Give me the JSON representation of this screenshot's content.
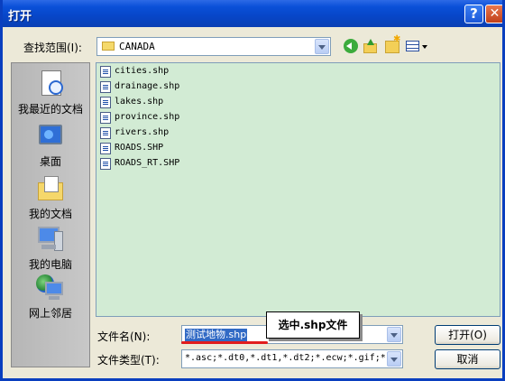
{
  "window": {
    "title": "打开",
    "help_symbol": "?",
    "close_symbol": "✕"
  },
  "lookin": {
    "label": "查找范围(I):",
    "value": "CANADA"
  },
  "toolbar": {
    "icons": [
      "back-icon",
      "up-folder-icon",
      "new-folder-icon",
      "view-menu-icon"
    ]
  },
  "places": [
    {
      "label": "我最近的文档",
      "icon": "recent-documents-icon"
    },
    {
      "label": "桌面",
      "icon": "desktop-icon"
    },
    {
      "label": "我的文档",
      "icon": "my-documents-icon"
    },
    {
      "label": "我的电脑",
      "icon": "my-computer-icon"
    },
    {
      "label": "网上邻居",
      "icon": "network-places-icon"
    }
  ],
  "files": [
    "cities.shp",
    "drainage.shp",
    "lakes.shp",
    "province.shp",
    "rivers.shp",
    "ROADS.SHP",
    "ROADS_RT.SHP"
  ],
  "filename": {
    "label": "文件名(N):",
    "value": "测试地物.shp"
  },
  "filetype": {
    "label": "文件类型(T):",
    "value": "*.asc;*.dt0,*.dt1,*.dt2;*.ecw;*.gif;*"
  },
  "buttons": {
    "open": "打开(O)",
    "cancel": "取消"
  },
  "annotation": {
    "text": "选中.shp文件",
    "underline_color": "#e11d1d"
  },
  "colors": {
    "titlebar": "#0a50d8",
    "dialog_bg": "#ece9d8",
    "filelist_bg": "#d2ebd4",
    "selection": "#316ac5"
  }
}
